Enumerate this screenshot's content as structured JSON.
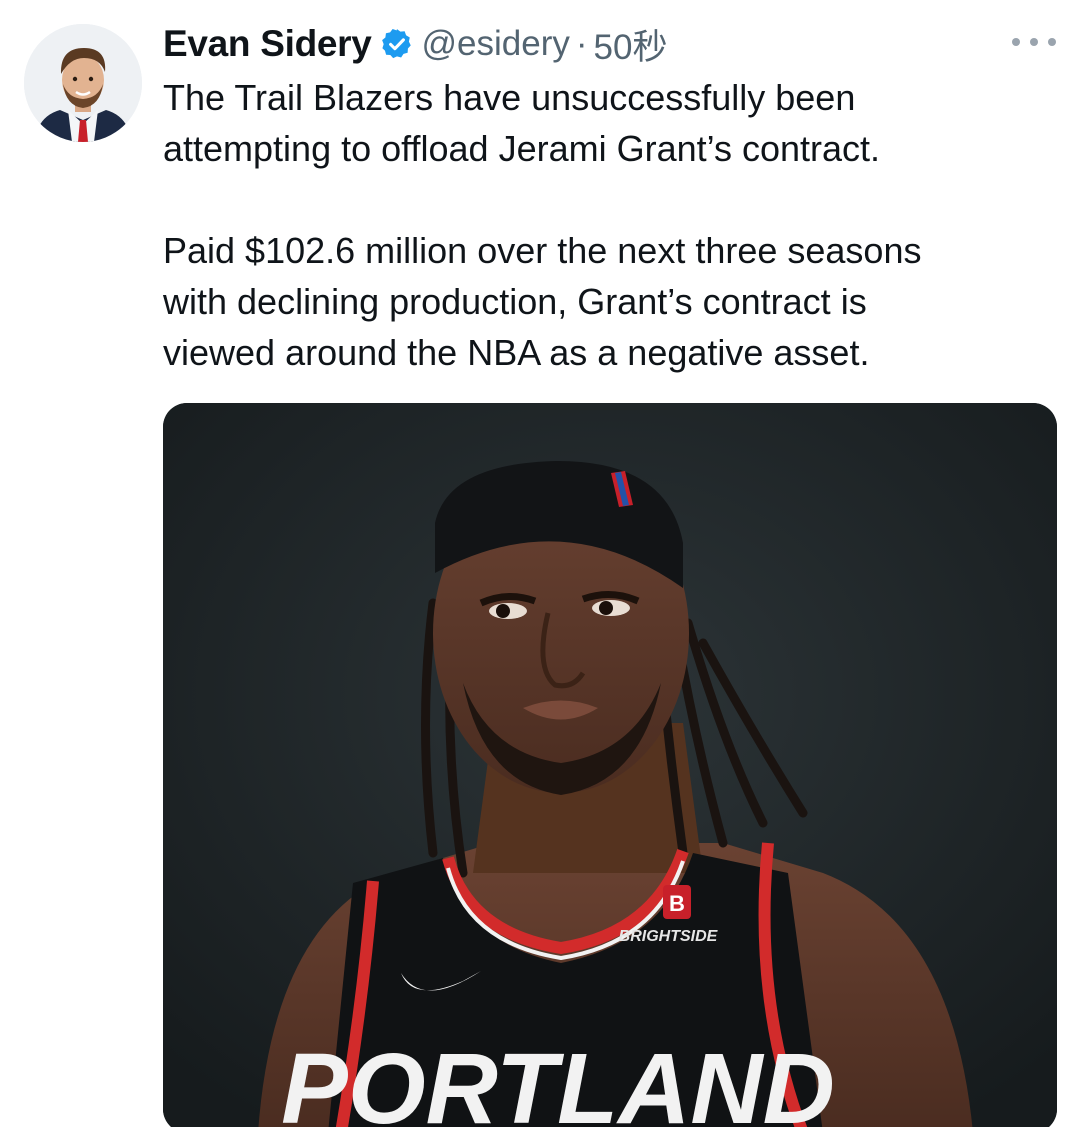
{
  "tweet": {
    "author": {
      "display_name": "Evan Sidery",
      "handle": "@esidery",
      "verified": true,
      "avatar_icon": "person-avatar"
    },
    "separator": "·",
    "timestamp": "50秒",
    "more_icon": "ellipsis-icon",
    "text": "The Trail Blazers have unsuccessfully been\nattempting to offload Jerami Grant’s contract.\n\nPaid $102.6 million over the next three seasons\nwith declining production, Grant’s contract is\nviewed around the NBA as a negative asset.",
    "media": {
      "jersey_sponsor": "BRIGHTSIDE",
      "jersey_team": "PORTLAND",
      "sponsor_logo": "B"
    }
  },
  "colors": {
    "verified_blue": "#1d9bf0",
    "muted_text": "#536471",
    "jersey_red": "#d22b2b",
    "jersey_black": "#101214"
  }
}
